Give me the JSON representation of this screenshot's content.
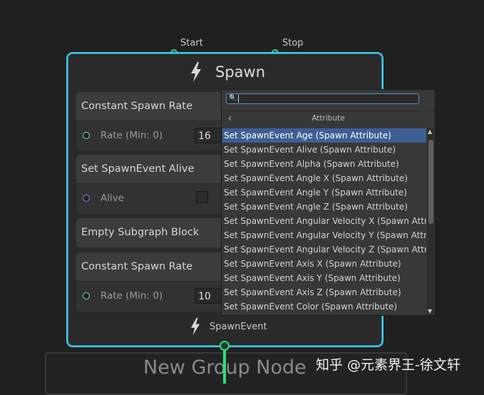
{
  "ports": {
    "start": "Start",
    "stop": "Stop"
  },
  "node": {
    "title": "Spawn",
    "footer": "SpawnEvent",
    "blocks": [
      {
        "title": "Constant Spawn Rate",
        "row_label": "Rate (Min: 0)",
        "value": "16"
      },
      {
        "title": "Set SpawnEvent Alive",
        "row_label": "Alive"
      },
      {
        "title": "Empty Subgraph Block"
      },
      {
        "title": "Constant Spawn Rate",
        "row_label": "Rate (Min: 0)",
        "value": "10"
      }
    ]
  },
  "group_node": {
    "title": "New Group Node"
  },
  "popup": {
    "search_value": "",
    "title": "Attribute",
    "items": [
      "Set SpawnEvent Age  (Spawn Attribute)",
      "Set SpawnEvent Alive  (Spawn Attribute)",
      "Set SpawnEvent Alpha  (Spawn Attribute)",
      "Set SpawnEvent Angle X  (Spawn Attribute)",
      "Set SpawnEvent Angle Y  (Spawn Attribute)",
      "Set SpawnEvent Angle Z  (Spawn Attribute)",
      "Set SpawnEvent Angular Velocity X  (Spawn Attribu",
      "Set SpawnEvent Angular Velocity Y  (Spawn Attribu",
      "Set SpawnEvent Angular Velocity Z  (Spawn Attribu",
      "Set SpawnEvent Axis X  (Spawn Attribute)",
      "Set SpawnEvent Axis Y  (Spawn Attribute)",
      "Set SpawnEvent Axis Z  (Spawn Attribute)",
      "Set SpawnEvent Color  (Spawn Attribute)"
    ]
  },
  "watermark": "知乎 @元素界王-徐文轩",
  "colors": {
    "node_border": "#48c9e8",
    "port": "#2fd08f",
    "selected": "#3d5f94"
  }
}
